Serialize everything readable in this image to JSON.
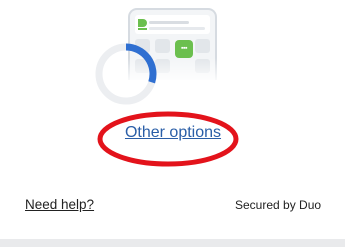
{
  "illustration": {
    "phone_icon": "phone-push-illustration",
    "app_icon": "duo-app-icon",
    "app_icon_text": "▪▪▪",
    "notification_icon": "duo-logo-icon"
  },
  "loading": {
    "icon": "loading-spinner-icon",
    "accent_color": "#2f6fd1",
    "track_color": "#eceef1"
  },
  "main": {
    "other_options_label": "Other options",
    "highlight_color": "#e3131b"
  },
  "footer": {
    "help_label": "Need help?",
    "secured_label": "Secured by Duo"
  }
}
